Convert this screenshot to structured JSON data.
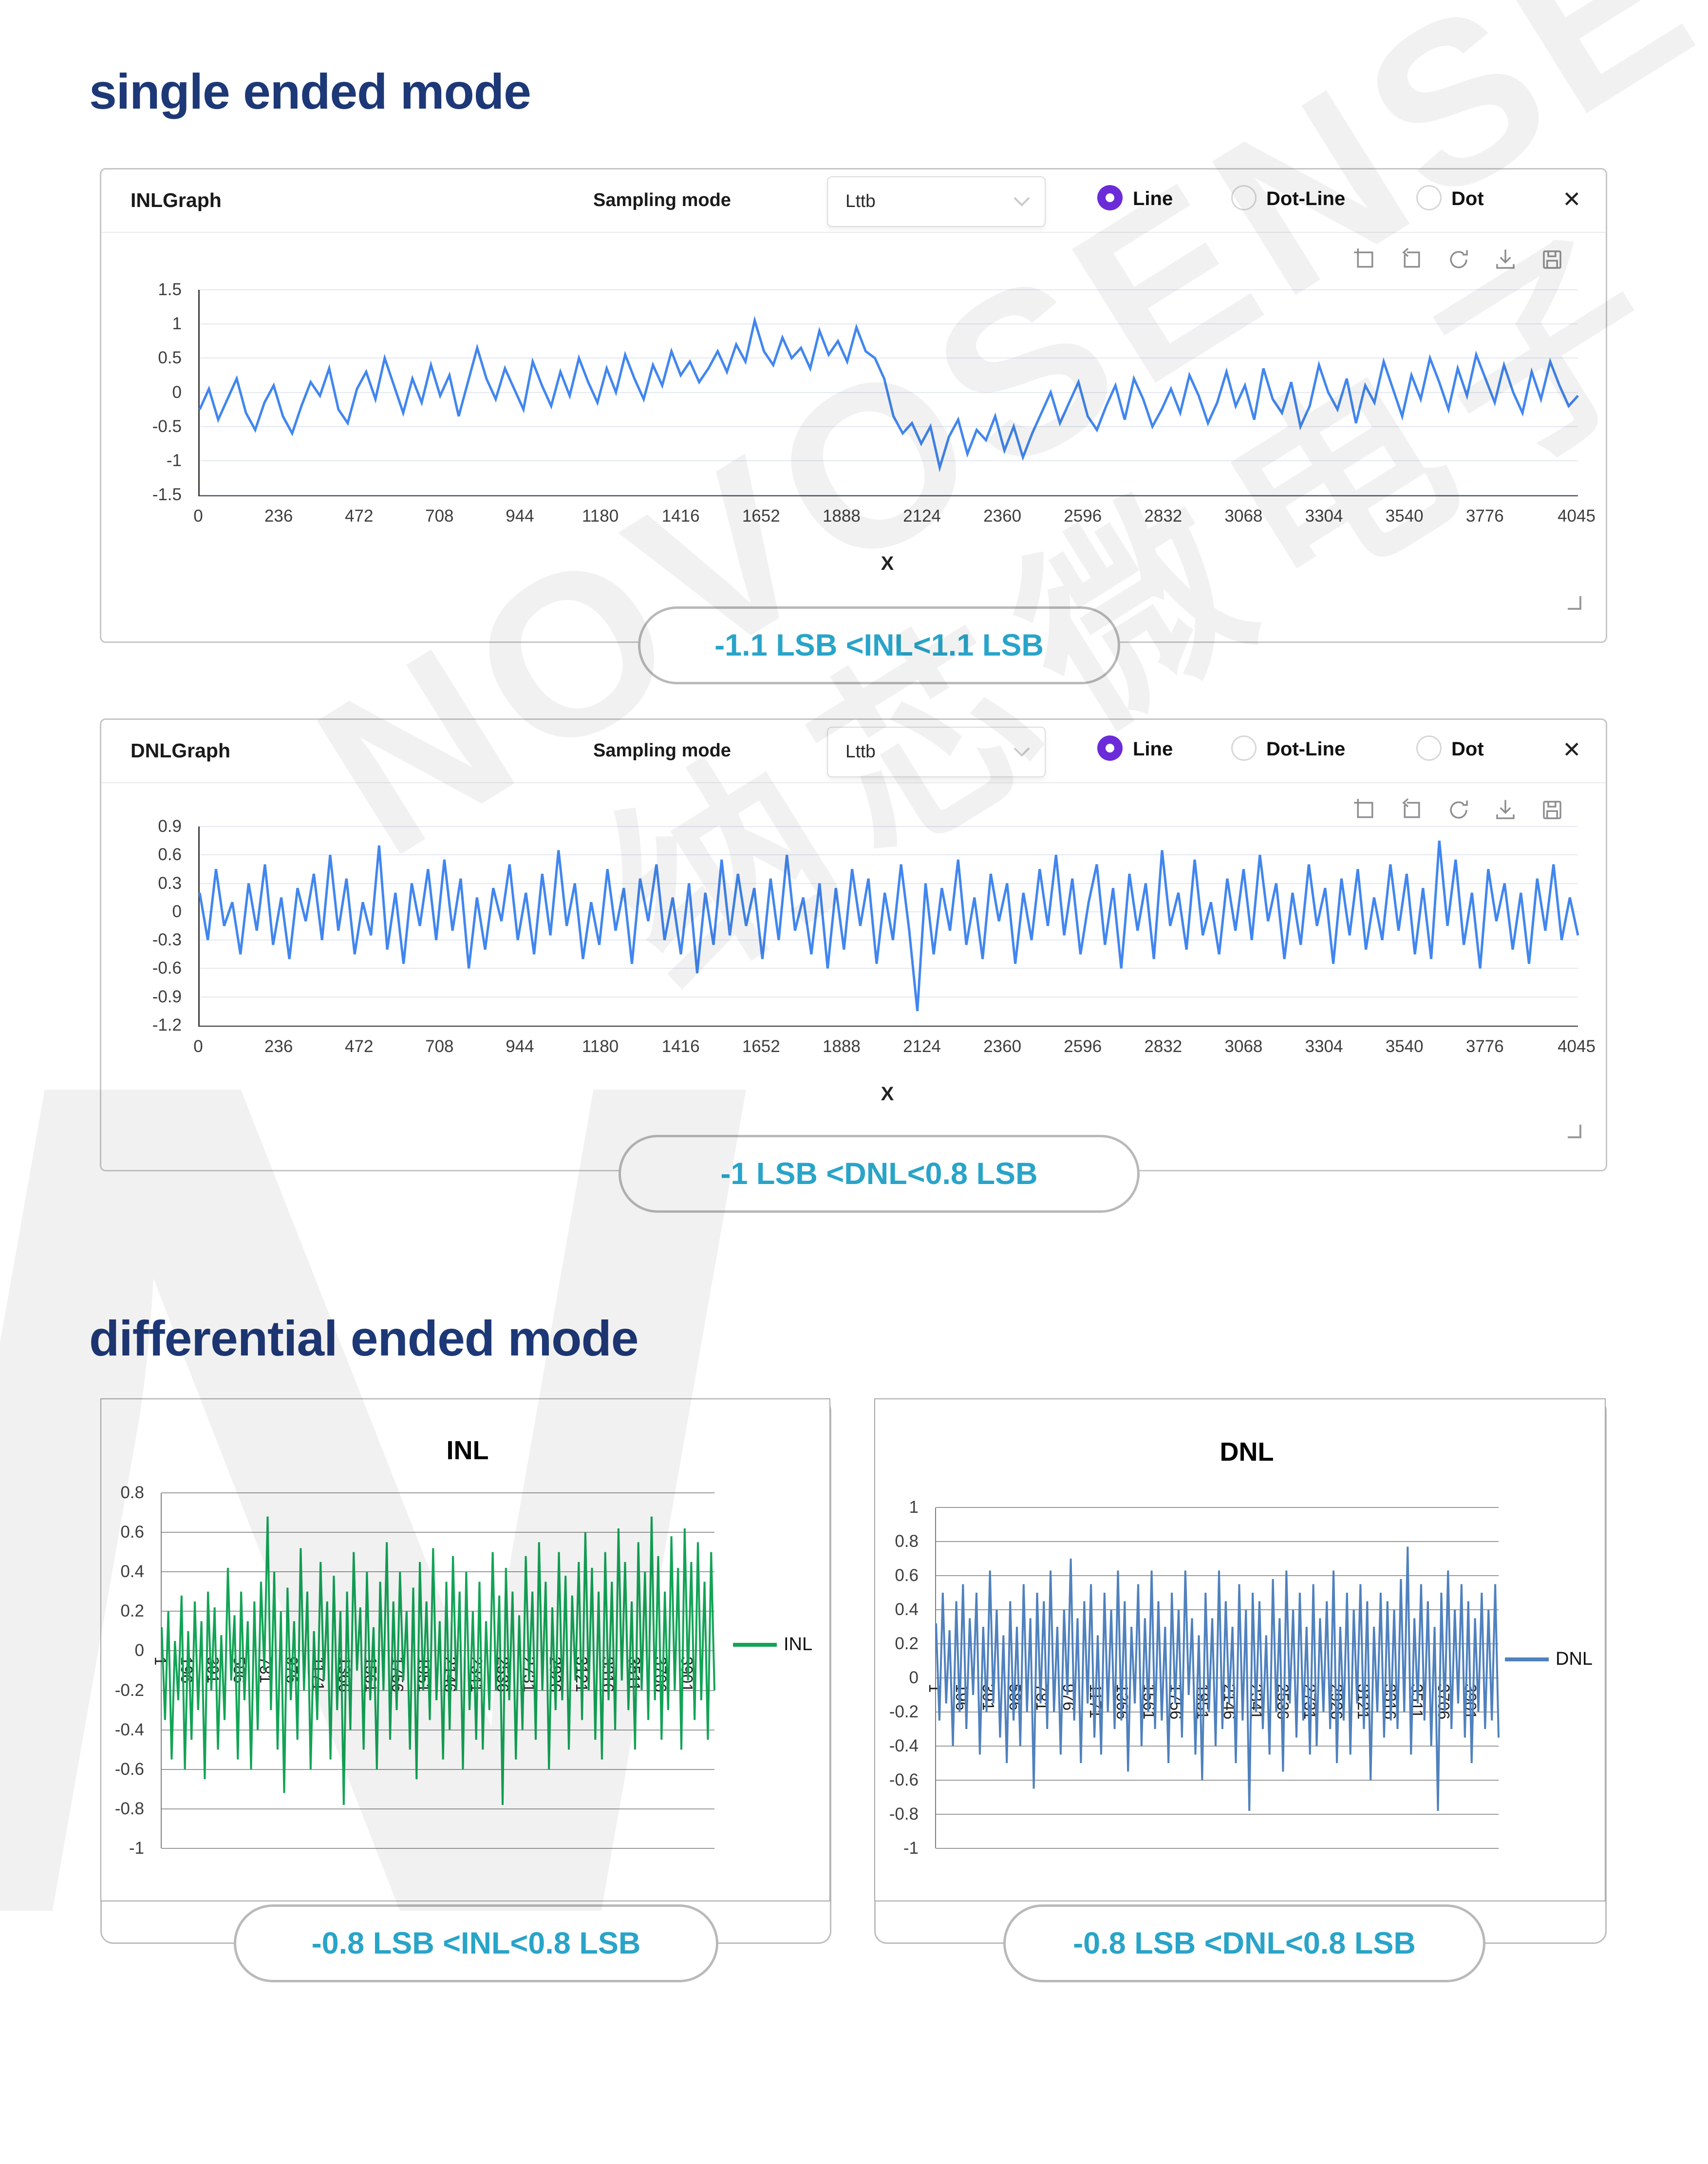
{
  "page": {
    "title_single": "single ended mode",
    "title_diff": "differential ended mode"
  },
  "panels": [
    {
      "title": "INLGraph"
    },
    {
      "title": "DNLGraph"
    }
  ],
  "controls": {
    "sampling_label": "Sampling mode",
    "dropdown_value": "Lttb",
    "radio_line": "Line",
    "radio_dotline": "Dot-Line",
    "radio_dot": "Dot",
    "selected_radio": "Line",
    "close_glyph": "✕",
    "toolbar_icons": [
      "zoom-box-icon",
      "zoom-back-icon",
      "refresh-icon",
      "download-icon",
      "save-icon"
    ]
  },
  "captions": {
    "single_inl": "-1.1 LSB <INL<1.1 LSB",
    "single_dnl": "-1 LSB <DNL<0.8 LSB",
    "diff_inl": "-0.8 LSB <INL<0.8 LSB",
    "diff_dnl": "-0.8 LSB <DNL<0.8 LSB"
  },
  "watermark": {
    "word": "NOVOSENSE",
    "cjk": "纳芯微电子",
    "letter": "N"
  },
  "colors": {
    "accent_navy": "#1d3877",
    "caption_teal": "#29a4c9",
    "radio_purple": "#6b2bd9",
    "line_blue": "#4186ef",
    "inl_green": "#12a456",
    "dnl_steelblue": "#4f81bd"
  },
  "chart_data": [
    {
      "id": "inl-top",
      "type": "line",
      "title": "",
      "xlabel": "X",
      "color": "#4186ef",
      "stroke": 5,
      "grid_dark": false,
      "ymin": -1.5,
      "ymax": 1.5,
      "yticks": [
        1.5,
        1,
        0.5,
        0,
        -0.5,
        -1,
        -1.5
      ],
      "xmin": 0,
      "xmax": 4045,
      "xticks": [
        0,
        236,
        472,
        708,
        944,
        1180,
        1416,
        1652,
        1888,
        2124,
        2360,
        2596,
        2832,
        3068,
        3304,
        3540,
        3776,
        4045
      ],
      "rotated": false,
      "values": [
        -0.25,
        0.05,
        -0.4,
        -0.1,
        0.2,
        -0.3,
        -0.55,
        -0.15,
        0.1,
        -0.35,
        -0.6,
        -0.2,
        0.15,
        -0.05,
        0.35,
        -0.25,
        -0.45,
        0.05,
        0.3,
        -0.1,
        0.5,
        0.1,
        -0.3,
        0.2,
        -0.15,
        0.4,
        -0.05,
        0.25,
        -0.35,
        0.15,
        0.65,
        0.2,
        -0.1,
        0.35,
        0.05,
        -0.25,
        0.45,
        0.1,
        -0.2,
        0.3,
        -0.05,
        0.5,
        0.15,
        -0.15,
        0.35,
        0,
        0.55,
        0.2,
        -0.1,
        0.4,
        0.1,
        0.6,
        0.25,
        0.45,
        0.15,
        0.35,
        0.6,
        0.3,
        0.7,
        0.45,
        1.05,
        0.6,
        0.4,
        0.8,
        0.5,
        0.65,
        0.35,
        0.9,
        0.55,
        0.75,
        0.45,
        0.95,
        0.6,
        0.5,
        0.2,
        -0.35,
        -0.6,
        -0.45,
        -0.75,
        -0.5,
        -1.1,
        -0.65,
        -0.4,
        -0.9,
        -0.55,
        -0.7,
        -0.35,
        -0.85,
        -0.5,
        -0.95,
        -0.6,
        -0.3,
        0,
        -0.45,
        -0.15,
        0.15,
        -0.35,
        -0.55,
        -0.2,
        0.1,
        -0.4,
        0.2,
        -0.1,
        -0.5,
        -0.25,
        0.05,
        -0.3,
        0.25,
        -0.05,
        -0.45,
        -0.15,
        0.3,
        -0.2,
        0.1,
        -0.4,
        0.35,
        -0.1,
        -0.3,
        0.15,
        -0.5,
        -0.2,
        0.4,
        0,
        -0.25,
        0.2,
        -0.45,
        0.1,
        -0.15,
        0.45,
        0.05,
        -0.35,
        0.25,
        -0.1,
        0.5,
        0.15,
        -0.25,
        0.35,
        -0.05,
        0.55,
        0.2,
        -0.15,
        0.4,
        0,
        -0.3,
        0.3,
        -0.1,
        0.45,
        0.1,
        -0.2,
        -0.05
      ]
    },
    {
      "id": "dnl-top",
      "type": "line",
      "title": "",
      "xlabel": "X",
      "color": "#4186ef",
      "stroke": 5,
      "grid_dark": false,
      "ymin": -1.2,
      "ymax": 0.9,
      "yticks": [
        0.9,
        0.6,
        0.3,
        0,
        -0.3,
        -0.6,
        -0.9,
        -1.2
      ],
      "xmin": 0,
      "xmax": 4045,
      "xticks": [
        0,
        236,
        472,
        708,
        944,
        1180,
        1416,
        1652,
        1888,
        2124,
        2360,
        2596,
        2832,
        3068,
        3304,
        3540,
        3776,
        4045
      ],
      "rotated": false,
      "values": [
        0.2,
        -0.3,
        0.45,
        -0.15,
        0.1,
        -0.45,
        0.3,
        -0.2,
        0.5,
        -0.35,
        0.15,
        -0.5,
        0.25,
        -0.1,
        0.4,
        -0.3,
        0.6,
        -0.2,
        0.35,
        -0.45,
        0.1,
        -0.25,
        0.7,
        -0.4,
        0.2,
        -0.55,
        0.3,
        -0.15,
        0.45,
        -0.3,
        0.55,
        -0.2,
        0.35,
        -0.6,
        0.15,
        -0.4,
        0.25,
        -0.1,
        0.5,
        -0.3,
        0.2,
        -0.45,
        0.4,
        -0.25,
        0.65,
        -0.15,
        0.3,
        -0.5,
        0.1,
        -0.35,
        0.45,
        -0.2,
        0.25,
        -0.55,
        0.35,
        -0.1,
        0.5,
        -0.3,
        0.15,
        -0.45,
        0.3,
        -0.65,
        0.2,
        -0.35,
        0.55,
        -0.25,
        0.4,
        -0.15,
        0.25,
        -0.5,
        0.35,
        -0.3,
        0.6,
        -0.2,
        0.15,
        -0.45,
        0.3,
        -0.6,
        0.25,
        -0.4,
        0.45,
        -0.15,
        0.35,
        -0.55,
        0.2,
        -0.3,
        0.5,
        -0.2,
        -1.05,
        0.3,
        -0.45,
        0.25,
        -0.2,
        0.55,
        -0.35,
        0.15,
        -0.5,
        0.4,
        -0.1,
        0.3,
        -0.55,
        0.2,
        -0.3,
        0.45,
        -0.15,
        0.6,
        -0.25,
        0.35,
        -0.45,
        0.1,
        0.5,
        -0.35,
        0.25,
        -0.6,
        0.4,
        -0.2,
        0.3,
        -0.5,
        0.65,
        -0.15,
        0.2,
        -0.4,
        0.55,
        -0.25,
        0.1,
        -0.45,
        0.35,
        -0.2,
        0.45,
        -0.3,
        0.6,
        -0.1,
        0.3,
        -0.5,
        0.2,
        -0.35,
        0.5,
        -0.15,
        0.25,
        -0.55,
        0.35,
        -0.25,
        0.45,
        -0.4,
        0.15,
        -0.3,
        0.5,
        -0.2,
        0.4,
        -0.45,
        0.25,
        -0.5,
        0.75,
        -0.15,
        0.55,
        -0.35,
        0.2,
        -0.6,
        0.45,
        -0.1,
        0.3,
        -0.4,
        0.2,
        -0.55,
        0.35,
        -0.2,
        0.5,
        -0.3,
        0.15,
        -0.25
      ]
    },
    {
      "id": "inl-diff",
      "type": "line",
      "title": "INL",
      "legend": "INL",
      "xlabel": "",
      "color": "#12a456",
      "stroke": 4,
      "grid_dark": true,
      "ymin": -1,
      "ymax": 0.8,
      "yticks": [
        0.8,
        0.6,
        0.4,
        0.2,
        0,
        -0.2,
        -0.4,
        -0.6,
        -0.8,
        -1
      ],
      "xmin": 1,
      "xmax": 4095,
      "xticks": [
        1,
        196,
        391,
        586,
        781,
        976,
        1171,
        1366,
        1561,
        1756,
        1951,
        2146,
        2341,
        2536,
        2731,
        2926,
        3121,
        3316,
        3511,
        3706,
        3901
      ],
      "rotated": true,
      "values": [
        0.12,
        -0.35,
        0.2,
        -0.55,
        0.05,
        -0.25,
        0.28,
        -0.6,
        0.1,
        -0.45,
        0.25,
        -0.3,
        0.15,
        -0.65,
        0.3,
        -0.2,
        0.22,
        -0.5,
        0.08,
        -0.35,
        0.42,
        -0.15,
        0.18,
        -0.55,
        0.3,
        -0.25,
        0.15,
        -0.6,
        0.25,
        -0.4,
        0.35,
        -0.1,
        0.68,
        -0.3,
        0.4,
        -0.5,
        0.2,
        -0.72,
        0.32,
        -0.25,
        0.15,
        -0.45,
        0.52,
        -0.2,
        0.3,
        -0.6,
        0.1,
        -0.35,
        0.45,
        -0.15,
        0.25,
        -0.55,
        0.38,
        -0.3,
        0.2,
        -0.78,
        0.3,
        -0.4,
        0.5,
        -0.1,
        0.22,
        -0.5,
        0.4,
        -0.25,
        0.12,
        -0.6,
        0.35,
        -0.2,
        0.55,
        -0.45,
        0.25,
        -0.3,
        0.4,
        -0.15,
        0.2,
        -0.5,
        0.32,
        -0.65,
        0.45,
        -0.2,
        0.25,
        -0.35,
        0.52,
        -0.25,
        0.15,
        -0.55,
        0.35,
        -0.4,
        0.48,
        -0.2,
        0.3,
        -0.6,
        0.4,
        -0.3,
        0.2,
        -0.45,
        0.35,
        -0.5,
        0.15,
        -0.3,
        0.5,
        -0.2,
        0.28,
        -0.78,
        0.42,
        -0.25,
        0.3,
        -0.55,
        0.18,
        -0.4,
        0.48,
        -0.15,
        0.3,
        -0.45,
        0.55,
        -0.2,
        0.35,
        -0.6,
        0.22,
        -0.3,
        0.5,
        -0.25,
        0.38,
        -0.5,
        0.28,
        -0.15,
        0.45,
        -0.35,
        0.6,
        -0.2,
        0.42,
        -0.45,
        0.3,
        -0.55,
        0.5,
        -0.25,
        0.35,
        -0.4,
        0.62,
        -0.15,
        0.45,
        -0.3,
        0.25,
        -0.5,
        0.55,
        -0.2,
        0.4,
        -0.35,
        0.68,
        -0.25,
        0.48,
        -0.45,
        0.3,
        -0.3,
        0.58,
        -0.2,
        0.42,
        -0.5,
        0.62,
        -0.15,
        0.45,
        -0.35,
        0.55,
        -0.25,
        0.35,
        -0.45,
        0.5,
        -0.2
      ]
    },
    {
      "id": "dnl-diff",
      "type": "line",
      "title": "DNL",
      "legend": "DNL",
      "xlabel": "",
      "color": "#4f81bd",
      "stroke": 4,
      "grid_dark": true,
      "ymin": -1,
      "ymax": 1,
      "yticks": [
        1,
        0.8,
        0.6,
        0.4,
        0.2,
        0,
        -0.2,
        -0.4,
        -0.6,
        -0.8,
        -1
      ],
      "xmin": 1,
      "xmax": 4095,
      "xticks": [
        1,
        196,
        391,
        586,
        781,
        976,
        1171,
        1366,
        1561,
        1756,
        1951,
        2146,
        2341,
        2536,
        2731,
        2926,
        3121,
        3316,
        3511,
        3706,
        3901
      ],
      "rotated": true,
      "values": [
        0.32,
        -0.25,
        0.5,
        -0.15,
        0.28,
        -0.4,
        0.45,
        -0.2,
        0.55,
        -0.3,
        0.35,
        -0.1,
        0.5,
        -0.45,
        0.3,
        -0.2,
        0.63,
        -0.15,
        0.4,
        -0.35,
        0.25,
        -0.5,
        0.45,
        -0.25,
        0.3,
        -0.4,
        0.55,
        -0.2,
        0.35,
        -0.65,
        0.5,
        -0.15,
        0.45,
        -0.3,
        0.63,
        -0.2,
        0.3,
        -0.45,
        0.4,
        -0.1,
        0.7,
        -0.25,
        0.35,
        -0.5,
        0.45,
        -0.15,
        0.55,
        -0.35,
        0.25,
        -0.45,
        0.5,
        -0.2,
        0.4,
        -0.3,
        0.63,
        -0.25,
        0.45,
        -0.55,
        0.3,
        -0.15,
        0.55,
        -0.4,
        0.35,
        -0.2,
        0.63,
        -0.3,
        0.45,
        -0.25,
        0.3,
        -0.5,
        0.5,
        -0.15,
        0.4,
        -0.35,
        0.63,
        -0.1,
        0.35,
        -0.45,
        0.25,
        -0.6,
        0.5,
        -0.2,
        0.35,
        -0.4,
        0.63,
        -0.3,
        0.45,
        -0.15,
        0.3,
        -0.5,
        0.55,
        -0.25,
        0.4,
        -0.78,
        0.5,
        -0.2,
        0.45,
        -0.3,
        0.25,
        -0.45,
        0.58,
        -0.2,
        0.35,
        -0.55,
        0.63,
        -0.15,
        0.4,
        -0.35,
        0.5,
        -0.25,
        0.3,
        -0.45,
        0.55,
        -0.4,
        0.35,
        -0.2,
        0.45,
        -0.3,
        0.63,
        -0.5,
        0.3,
        -0.25,
        0.5,
        -0.45,
        0.4,
        -0.15,
        0.55,
        -0.3,
        0.45,
        -0.6,
        0.3,
        -0.2,
        0.5,
        -0.35,
        0.45,
        -0.25,
        0.4,
        -0.3,
        0.58,
        -0.2,
        0.77,
        -0.45,
        0.35,
        -0.15,
        0.55,
        -0.25,
        0.45,
        -0.4,
        0.3,
        -0.78,
        0.5,
        -0.2,
        0.63,
        -0.3,
        0.4,
        -0.15,
        0.55,
        -0.35,
        0.45,
        -0.5,
        0.35,
        -0.2,
        0.5,
        -0.3,
        0.4,
        -0.25,
        0.55,
        -0.35
      ]
    }
  ]
}
